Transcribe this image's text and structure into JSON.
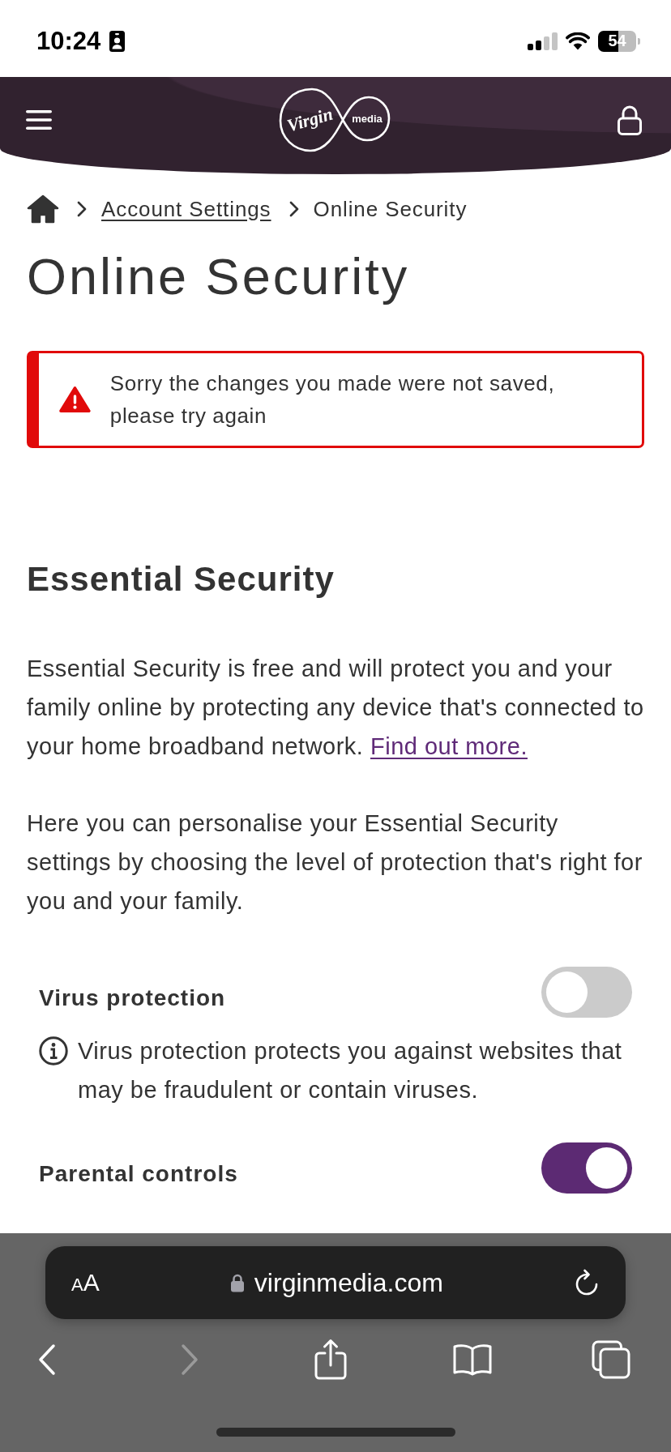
{
  "status_bar": {
    "time": "10:24",
    "battery": "54"
  },
  "header": {
    "logo": {
      "script": "Virgin",
      "wordmark": "media"
    }
  },
  "breadcrumb": [
    {
      "kind": "home"
    },
    {
      "kind": "link",
      "label": "Account Settings"
    },
    {
      "kind": "current",
      "label": "Online Security"
    }
  ],
  "title": "Online Security",
  "alert": {
    "kind": "error",
    "message": "Sorry the changes you made were not saved, please try again"
  },
  "section": {
    "heading": "Essential Security",
    "paragraphs": [
      {
        "text": "Essential Security is free and will protect you and your family online by protecting any device that's connected to your home broadband network.",
        "link": "Find out more."
      },
      {
        "text": "Here you can personalise your Essential Security settings by choosing the level of protection that's right for you and your family."
      }
    ]
  },
  "settings": [
    {
      "label": "Virus protection",
      "on": false,
      "info": "Virus protection protects you against websites that may be fraudulent or contain viruses."
    },
    {
      "label": "Parental controls",
      "on": true
    }
  ],
  "browser": {
    "text_size": "AA",
    "secure": true,
    "url": "virginmedia.com",
    "nav": [
      {
        "kind": "back",
        "disabled": false
      },
      {
        "kind": "forward",
        "disabled": true
      },
      {
        "kind": "share",
        "disabled": false
      },
      {
        "kind": "bookmarks",
        "disabled": false
      },
      {
        "kind": "tabs",
        "disabled": false
      }
    ]
  }
}
